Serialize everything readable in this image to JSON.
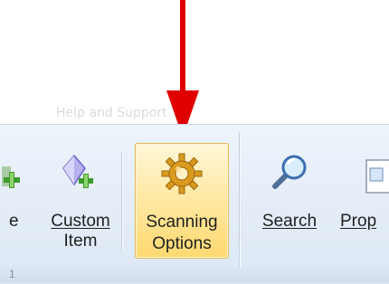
{
  "ribbon_group_title": "Help and Support",
  "buttons": {
    "partial_left": {
      "label": "e"
    },
    "custom_item": {
      "label_line1": "Custom",
      "label_line2": "Item"
    },
    "scanning_options": {
      "label_line1": "Scanning",
      "label_line2": "Options"
    },
    "search": {
      "label": "Search"
    },
    "properties_partial": {
      "label": "Prop"
    }
  },
  "bottom_fragment": "1",
  "colors": {
    "arrow": "#e00000",
    "selected_button": "#ffe9a6",
    "ribbon_background": "#e6eef8"
  },
  "icons": {
    "left_partial": "green-plus-icon",
    "custom_item": "purple-gem-plus-icon",
    "scanning_options": "gold-gear-icon",
    "search": "magnifier-icon",
    "properties": "document-icon"
  }
}
